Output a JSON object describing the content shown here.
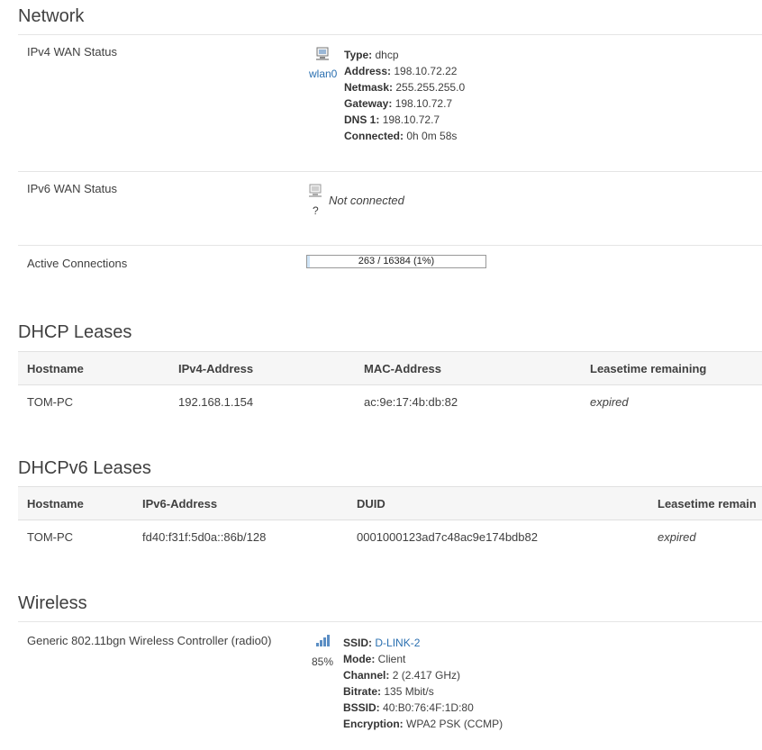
{
  "network": {
    "title": "Network",
    "ipv4": {
      "label": "IPv4 WAN Status",
      "iface": "wlan0",
      "type_label": "Type:",
      "type": "dhcp",
      "address_label": "Address:",
      "address": "198.10.72.22",
      "netmask_label": "Netmask:",
      "netmask": "255.255.255.0",
      "gateway_label": "Gateway:",
      "gateway": "198.10.72.7",
      "dns_label": "DNS 1:",
      "dns": "198.10.72.7",
      "connected_label": "Connected:",
      "connected": "0h 0m 58s"
    },
    "ipv6": {
      "label": "IPv6 WAN Status",
      "iface": "?",
      "status": "Not connected"
    },
    "active_connections": {
      "label": "Active Connections",
      "text": "263 / 16384 (1%)",
      "fraction": 0.016
    }
  },
  "dhcp": {
    "title": "DHCP Leases",
    "headers": [
      "Hostname",
      "IPv4-Address",
      "MAC-Address",
      "Leasetime remaining"
    ],
    "rows": [
      {
        "hostname": "TOM-PC",
        "address": "192.168.1.154",
        "mac": "ac:9e:17:4b:db:82",
        "lease": "expired"
      }
    ]
  },
  "dhcpv6": {
    "title": "DHCPv6 Leases",
    "headers": [
      "Hostname",
      "IPv6-Address",
      "DUID",
      "Leasetime remain"
    ],
    "rows": [
      {
        "hostname": "TOM-PC",
        "address": "fd40:f31f:5d0a::86b/128",
        "duid": "0001000123ad7c48ac9e174bdb82",
        "lease": "expired"
      }
    ]
  },
  "wireless": {
    "title": "Wireless",
    "device": "Generic 802.11bgn Wireless Controller (radio0)",
    "signal": "85%",
    "ssid_label": "SSID:",
    "ssid": "D-LINK-2",
    "mode_label": "Mode:",
    "mode": "Client",
    "channel_label": "Channel:",
    "channel": "2 (2.417 GHz)",
    "bitrate_label": "Bitrate:",
    "bitrate": "135 Mbit/s",
    "bssid_label": "BSSID:",
    "bssid": "40:B0:76:4F:1D:80",
    "encryption_label": "Encryption:",
    "encryption": "WPA2 PSK (CCMP)"
  },
  "colors": {
    "link": "#2a6fb0",
    "progress_fill": "#cfe4f7"
  }
}
